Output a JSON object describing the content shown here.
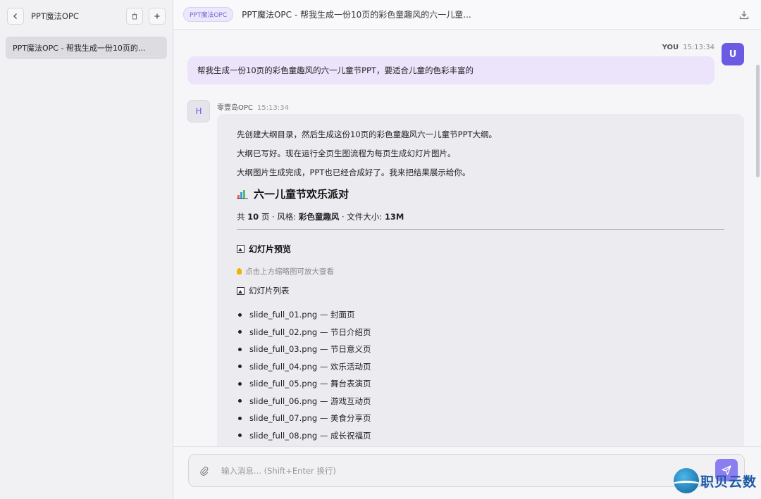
{
  "sidebar": {
    "title": "PPT魔法OPC",
    "back_icon": "chevron-left-icon",
    "delete_icon": "trash-icon",
    "add_icon": "plus-icon",
    "conversations": [
      {
        "label": "PPT魔法OPC - 帮我生成一份10页的..."
      }
    ]
  },
  "topbar": {
    "tag": "PPT魔法OPC",
    "title": "PPT魔法OPC - 帮我生成一份10页的彩色童趣风的六一儿童...",
    "download_icon": "download-icon"
  },
  "messages": {
    "user": {
      "name": "YOU",
      "time": "15:13:34",
      "avatar": "U",
      "text": "帮我生成一份10页的彩色童趣风的六一儿童节PPT，要适合儿童的色彩丰富的"
    },
    "bot": {
      "name": "零壹岛OPC",
      "time": "15:13:34",
      "avatar": "H",
      "para1": "先创建大纲目录，然后生成这份10页的彩色童趣风六一儿童节PPT大纲。",
      "para2": "大纲已写好。现在运行全页生图流程为每页生成幻灯片图片。",
      "para3": "大纲图片生成完成，PPT也已经合成好了。我来把结果展示给你。",
      "heading": "六一儿童节欢乐派对",
      "meta_prefix": "共",
      "meta_pages": "10",
      "meta_mid": "页 · 风格:",
      "meta_style": "彩色童趣风",
      "meta_size_label": "· 文件大小:",
      "meta_size": "13M",
      "preview_heading": "幻灯片预览",
      "tip": "点击上方缩略图可放大查看",
      "list_heading": "幻灯片列表",
      "slides": [
        "slide_full_01.png — 封面页",
        "slide_full_02.png — 节日介绍页",
        "slide_full_03.png — 节日意义页",
        "slide_full_04.png — 欢乐活动页",
        "slide_full_05.png — 舞台表演页",
        "slide_full_06.png — 游戏互动页",
        "slide_full_07.png — 美食分享页",
        "slide_full_08.png — 成长祝福页"
      ]
    }
  },
  "input": {
    "placeholder": "输入消息... (Shift+Enter 换行)",
    "attach_icon": "paperclip-icon",
    "send_icon": "send-icon"
  },
  "watermark": {
    "text": "职贝云数"
  },
  "colors": {
    "accent": "#6b5be3",
    "user_bubble": "#ebe4fb",
    "send_button": "#8a7ef0"
  }
}
